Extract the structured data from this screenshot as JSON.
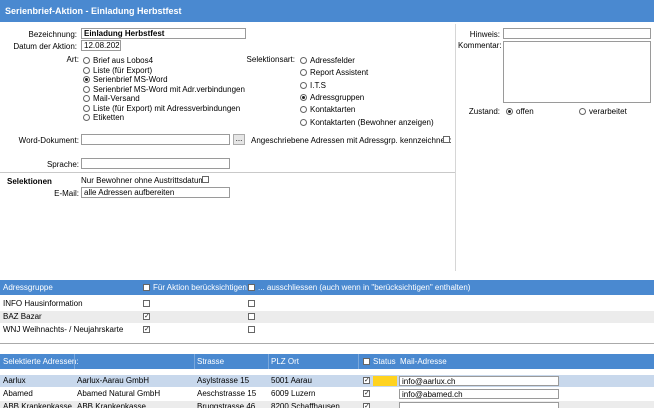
{
  "title": "Serienbrief-Aktion - Einladung Herbstfest",
  "form": {
    "bezeichnung_label": "Bezeichnung:",
    "bezeichnung_value": "Einladung Herbstfest",
    "datum_label": "Datum der Aktion:",
    "datum_value": "12.08.2021",
    "art_label": "Art:",
    "art_options": [
      {
        "label": "Brief aus Lobos4",
        "selected": false
      },
      {
        "label": "Liste (für Export)",
        "selected": false
      },
      {
        "label": "Serienbrief MS-Word",
        "selected": true
      },
      {
        "label": "Serienbrief MS-Word mit Adr.verbindungen",
        "selected": false
      },
      {
        "label": "Mail-Versand",
        "selected": false
      },
      {
        "label": "Liste (für Export) mit Adressverbindungen",
        "selected": false
      },
      {
        "label": "Etiketten",
        "selected": false
      }
    ],
    "selektionsart_label": "Selektionsart:",
    "selektionsart_options": [
      {
        "label": "Adressfelder",
        "selected": false
      },
      {
        "label": "Report Assistent",
        "selected": false
      },
      {
        "label": "I.T.S",
        "selected": false
      },
      {
        "label": "Adressgruppen",
        "selected": true
      },
      {
        "label": "Kontaktarten",
        "selected": false
      },
      {
        "label": "Kontaktarten (Bewohner anzeigen)",
        "selected": false
      }
    ],
    "word_label": "Word-Dokument:",
    "word_value": "",
    "browse_label": "...",
    "angeschrieben_label": "Angeschriebene Adressen mit Adressgrp. kennzeichnen:",
    "angeschrieben_checked": false,
    "sprache_label": "Sprache:",
    "sprache_value": "",
    "selektionen_label": "Selektionen",
    "nur_bewohner_label": "Nur Bewohner ohne Austrittsdatum:",
    "nur_bewohner_checked": false,
    "email_label": "E-Mail:",
    "email_value": "alle Adressen aufbereiten"
  },
  "side": {
    "hinweis_label": "Hinweis:",
    "hinweis_value": "",
    "kommentar_label": "Kommentar:",
    "kommentar_value": "",
    "zustand_label": "Zustand:",
    "zustand_options": [
      {
        "label": "offen",
        "selected": true
      },
      {
        "label": "verarbeitet",
        "selected": false
      }
    ]
  },
  "groups": {
    "headers": {
      "name": "Adressgruppe",
      "beruecksichtigen": "Für Aktion berücksichtigen",
      "ausschliessen": "... ausschliessen (auch wenn in \"berücksichtigen\" enthalten)"
    },
    "rows": [
      {
        "name": "INFO Hausinformation",
        "include": false,
        "exclude": false
      },
      {
        "name": "BAZ Bazar",
        "include": true,
        "exclude": false
      },
      {
        "name": "WNJ Weihnachts- / Neujahrskarte",
        "include": true,
        "exclude": false
      }
    ]
  },
  "addresses": {
    "headers": {
      "short": "Selektierte Adressen:",
      "name": "",
      "street": "Strasse",
      "plzort": "PLZ Ort",
      "status": "Status",
      "mail": "Mail-Adresse"
    },
    "rows": [
      {
        "short": "Aarlux",
        "name": "Aarlux-Aarau GmbH",
        "street": "Asylstrasse 15",
        "plzort": "5001 Aarau",
        "checked": true,
        "mail": "info@aarlux.ch"
      },
      {
        "short": "Abamed",
        "name": "Abamed Natural GmbH",
        "street": "Aeschstrasse 15",
        "plzort": "6009 Luzern",
        "checked": true,
        "mail": "info@abamed.ch"
      },
      {
        "short": "ABB Krankenkasse",
        "name": "ABB Krankenkasse",
        "street": "Bruggstrasse 46",
        "plzort": "8200 Schaffhausen",
        "checked": true,
        "mail": ""
      }
    ]
  },
  "colors": {
    "accent": "#4a89d0",
    "selected_row": "#c8d8ec",
    "highlight": "#ffd320"
  }
}
